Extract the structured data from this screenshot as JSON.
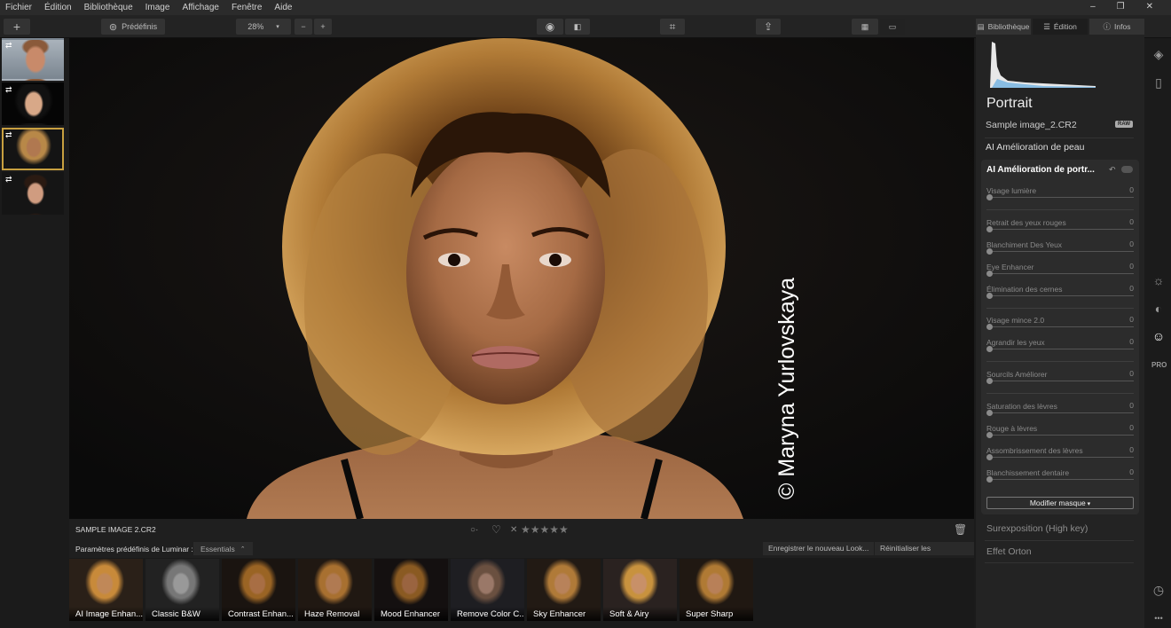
{
  "menu": [
    "Fichier",
    "Édition",
    "Bibliothèque",
    "Image",
    "Affichage",
    "Fenêtre",
    "Aide"
  ],
  "toolbar": {
    "add": "+",
    "presets_label": "Prédéfinis",
    "zoom": "28%",
    "zoom_minus": "−",
    "zoom_plus": "+"
  },
  "tabs": {
    "library": "Bibliothèque",
    "edit": "Édition",
    "info": "Infos"
  },
  "watermark": "© Maryna Yurlovskaya",
  "info": {
    "filename": "SAMPLE IMAGE  2.CR2",
    "rating": "★★★★★",
    "reject": "✕",
    "flag_symbol": "○·",
    "heart": "♡"
  },
  "preset_bar": {
    "label": "Paramètres prédéfinis de Luminar :",
    "category": "Essentials",
    "save_look": "Enregistrer le nouveau Look...",
    "reset": "Réinitialiser les ajustements"
  },
  "presets": [
    "AI Image Enhan...",
    "Classic B&W",
    "Contrast Enhan...",
    "Haze Removal",
    "Mood Enhancer",
    "Remove Color C...",
    "Sky Enhancer",
    "Soft & Airy",
    "Super Sharp"
  ],
  "panel": {
    "title": "Portrait",
    "filename": "Sample image_2.CR2",
    "raw_badge": "RAW",
    "skin_section": "AI Amélioration de peau",
    "portrait_section": "AI Amélioration de portr...",
    "mask_button": "Modifier masque",
    "high_key": "Surexposition (High key)",
    "orton": "Effet Orton"
  },
  "sliders": [
    {
      "name": "Visage lumière",
      "value": "0"
    },
    {
      "name": "Retrait des yeux rouges",
      "value": "0"
    },
    {
      "name": "Blanchiment Des Yeux",
      "value": "0"
    },
    {
      "name": "Eye Enhancer",
      "value": "0"
    },
    {
      "name": "Élimination des cernes",
      "value": "0"
    },
    {
      "name": "Visage mince 2.0",
      "value": "0"
    },
    {
      "name": "Agrandir les yeux",
      "value": "0"
    },
    {
      "name": "Sourcils Améliorer",
      "value": "0"
    },
    {
      "name": "Saturation des lèvres",
      "value": "0"
    },
    {
      "name": "Rouge à lèvres",
      "value": "0"
    },
    {
      "name": "Assombrissement des lèvres",
      "value": "0"
    },
    {
      "name": "Blanchissement dentaire",
      "value": "0"
    }
  ],
  "colors": {
    "accent": "#c8a040",
    "panel_bg": "#232323",
    "canvas_bg": "#0e0e0e"
  }
}
